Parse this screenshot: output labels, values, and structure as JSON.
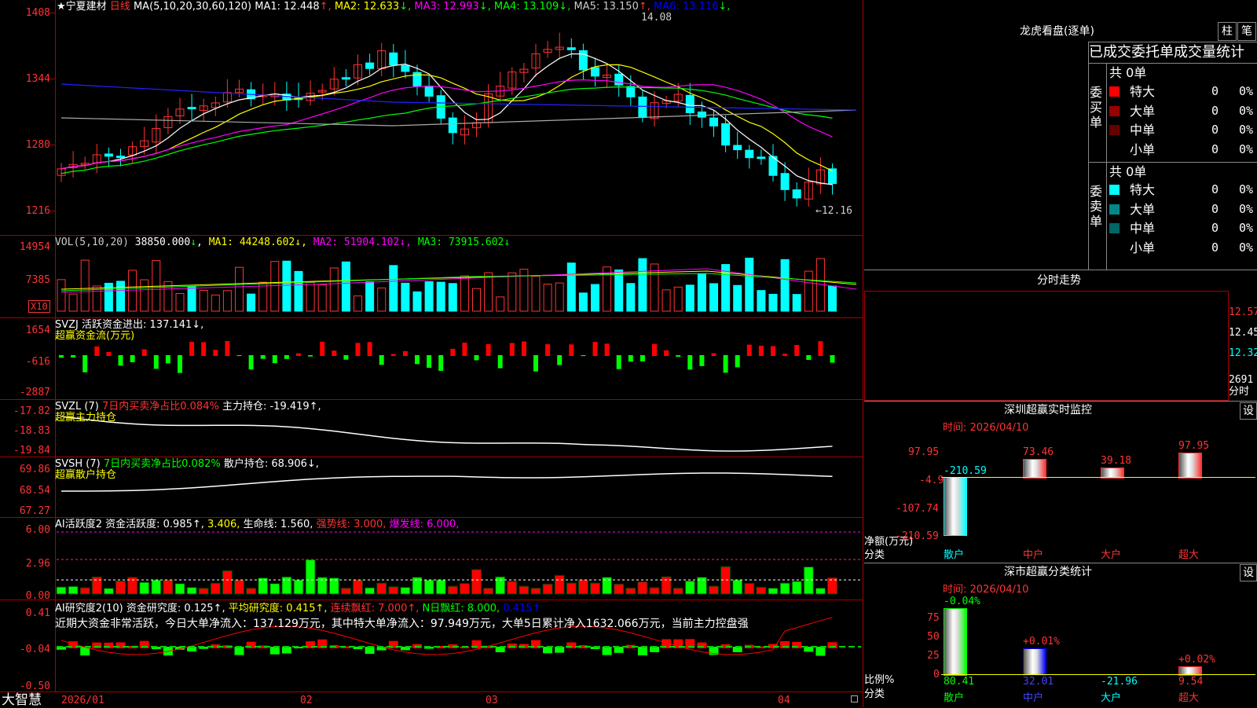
{
  "main": {
    "stock_name": "★宁夏建材",
    "period": "日线",
    "ma_title": "MA(5,10,20,30,60,120)",
    "ma": [
      {
        "label": "MA1:",
        "value": "12.448",
        "arrow": "↑",
        "color": "#ffffff"
      },
      {
        "label": "MA2:",
        "value": "12.633",
        "arrow": "↓",
        "color": "#ffff00"
      },
      {
        "label": "MA3:",
        "value": "12.993",
        "arrow": "↓",
        "color": "#ff00ff"
      },
      {
        "label": "MA4:",
        "value": "13.109",
        "arrow": "↓",
        "color": "#00ff00"
      },
      {
        "label": "MA5:",
        "value": "13.150",
        "arrow": "↑",
        "color": "#cccccc"
      },
      {
        "label": "MA6:",
        "value": "13.116",
        "arrow": "↓",
        "color": "#0000ff"
      }
    ],
    "high_mark": "14.08",
    "low_mark": "←12.16",
    "y_labels": [
      "1408",
      "1344",
      "1280",
      "1216"
    ]
  },
  "vol": {
    "title": "VOL(5,10,20)",
    "value": "38850.000",
    "arrow": "↓",
    "ma1": "MA1: 44248.602↓,",
    "ma2": "MA2: 51904.102↓,",
    "ma3": "MA3: 73915.602↓",
    "y_labels": [
      "14954",
      "7385"
    ],
    "unit": "X10"
  },
  "svzj": {
    "title": "SVZJ  活跃资金进出: 137.141↓,",
    "subtitle": "超赢资金流(万元)",
    "y_labels": [
      "1654",
      "-616",
      "-2887"
    ]
  },
  "svzl": {
    "title": "SVZL (7)",
    "ratio": "7日内买卖净占比0.084%",
    "hold": "主力持仓: -19.419↑,",
    "subtitle": "超赢主力持仓",
    "y_labels": [
      "-17.82",
      "-18.83",
      "-19.84"
    ]
  },
  "svsh": {
    "title": "SVSH (7)",
    "ratio": "7日内买卖净占比0.082%",
    "hold": "散户持仓: 68.906↓,",
    "subtitle": "超赢散户持仓",
    "y_labels": [
      "69.86",
      "68.54",
      "67.27"
    ]
  },
  "ai1": {
    "title": "AI活跃度2",
    "a": "资金活跃度: 0.985↑,",
    "b": "3.406,",
    "c": "生命线: 1.560,",
    "d": "强势线: 3.000,",
    "e": "爆发线: 6.000,",
    "y_labels": [
      "6.00",
      "2.96",
      "0.00"
    ]
  },
  "ai2": {
    "title": "AI研究度2(10)",
    "a": "资金研究度: 0.125↑,",
    "b": "平均研究度: 0.415↑,",
    "c": "连续飘红: 7.000↑,",
    "d": "N日飘红: 8.000,",
    "e": "0.415↑",
    "note": "近期大资金非常活跃，今日大单净流入：137.129万元，其中特大单净流入：97.949万元，大单5日累计净入1632.066万元，当前主力控盘强",
    "y_labels": [
      "0.41",
      "-0.04",
      "-0.50"
    ]
  },
  "bottom": {
    "logo": "大智慧",
    "dates": [
      "2026/01",
      "02",
      "03",
      "04"
    ]
  },
  "right": {
    "title": "龙虎看盘(逐单)",
    "btn1": "柱",
    "btn2": "笔",
    "table_title": "已成交委托单成交量统计",
    "buy_label": "委买单",
    "sell_label": "委卖单",
    "buy_total": "共 0单",
    "sell_total": "共 0单",
    "buy_rows": [
      {
        "name": "特大",
        "count": "0",
        "pct": "0%",
        "color": "#ff0000"
      },
      {
        "name": "大单",
        "count": "0",
        "pct": "0%",
        "color": "#990000"
      },
      {
        "name": "中单",
        "count": "0",
        "pct": "0%",
        "color": "#660000"
      },
      {
        "name": "小单",
        "count": "0",
        "pct": "0%",
        "color": ""
      }
    ],
    "sell_rows": [
      {
        "name": "特大",
        "count": "0",
        "pct": "0%",
        "color": "#00ffff"
      },
      {
        "name": "大单",
        "count": "0",
        "pct": "0%",
        "color": "#008888"
      },
      {
        "name": "中单",
        "count": "0",
        "pct": "0%",
        "color": "#006666"
      },
      {
        "name": "小单",
        "count": "0",
        "pct": "0%",
        "color": ""
      }
    ],
    "intraday_title": "分时走势",
    "intraday_prices": [
      "12.57",
      "12.45",
      "12.32"
    ],
    "intraday_vol": "2691",
    "intraday_unit": "分时",
    "monitor_title": "深圳超赢实时监控",
    "monitor_time": "时间: 2026/04/10",
    "monitor_btn": "设",
    "monitor_y": [
      "97.95",
      "-4.9",
      "-107.74",
      "-210.59"
    ],
    "monitor_axis": "净额(万元)",
    "monitor_cat_axis": "分类",
    "monitor_bars": [
      {
        "name": "散户",
        "value": "-210.59",
        "color": "#00ffff"
      },
      {
        "name": "中户",
        "value": "73.46",
        "color": "#ff3333"
      },
      {
        "name": "大户",
        "value": "39.18",
        "color": "#ff3333"
      },
      {
        "name": "超大",
        "value": "97.95",
        "color": "#ff3333"
      }
    ],
    "class_title": "深市超赢分类统计",
    "class_time": "时间: 2026/04/10",
    "class_btn": "设",
    "class_y": [
      "75",
      "50",
      "25",
      "0"
    ],
    "class_axis": "比例%",
    "class_cat_axis": "分类",
    "class_bars": [
      {
        "name": "散户",
        "value": "80.41",
        "delta": "-0.04%",
        "color": "#00ff00"
      },
      {
        "name": "中户",
        "value": "32.01",
        "delta": "+0.01%",
        "color": "#0000ff"
      },
      {
        "name": "大户",
        "value": "-21.96",
        "delta": "",
        "color": "#00ffff"
      },
      {
        "name": "超大",
        "value": "9.54",
        "delta": "+0.02%",
        "color": "#ff3333"
      }
    ]
  }
}
